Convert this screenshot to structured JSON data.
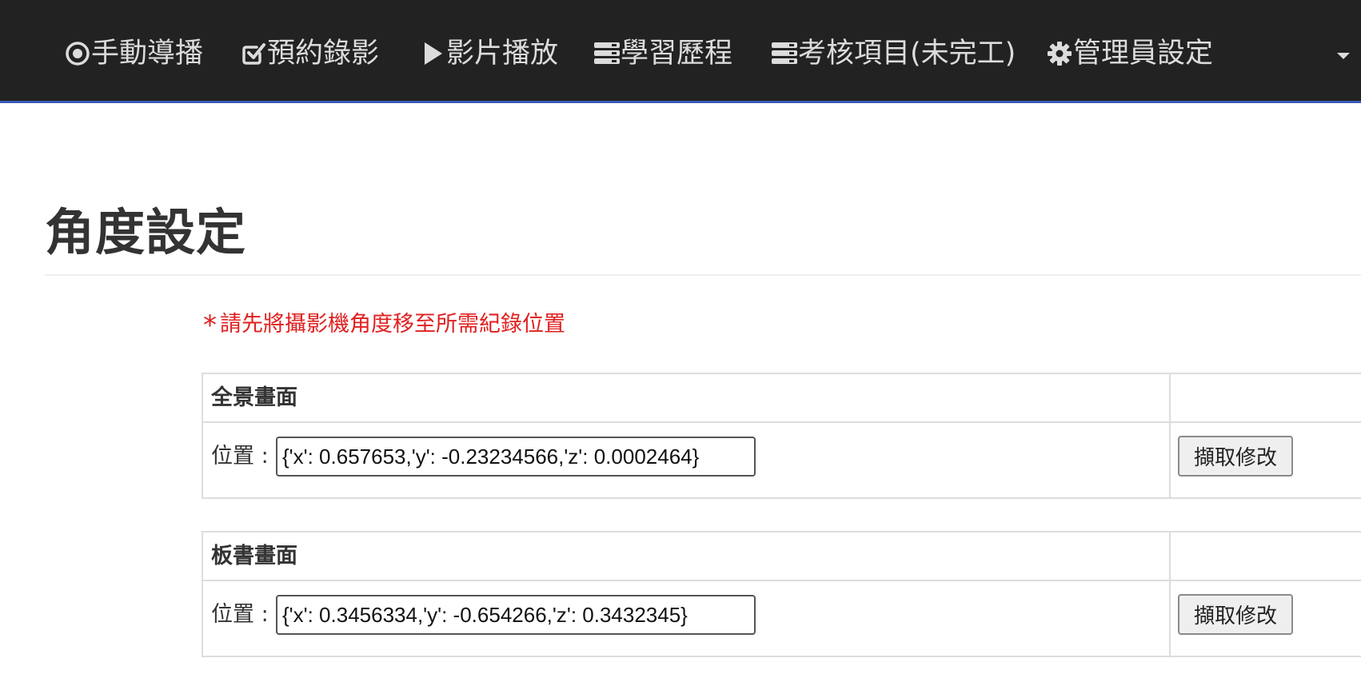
{
  "nav": {
    "items": [
      {
        "icon": "record-circle-icon",
        "label": "手動導播"
      },
      {
        "icon": "check-square-icon",
        "label": "預約錄影"
      },
      {
        "icon": "play-icon",
        "label": "影片播放"
      },
      {
        "icon": "server-stack-icon",
        "label": "學習歷程"
      },
      {
        "icon": "server-stack-icon",
        "label": "考核項目(未完工)"
      },
      {
        "icon": "gear-icon",
        "label": "管理員設定"
      }
    ]
  },
  "page": {
    "title": "角度設定",
    "notice_star": "*",
    "notice": "請先將攝影機角度移至所需紀錄位置"
  },
  "panels": [
    {
      "title": "全景畫面",
      "position_label": "位置 :",
      "position_value": "{'x': 0.657653,'y': -0.23234566,'z': 0.0002464}",
      "button_label": "擷取修改"
    },
    {
      "title": "板書畫面",
      "position_label": "位置 :",
      "position_value": "{'x': 0.3456334,'y': -0.654266,'z': 0.3432345}",
      "button_label": "擷取修改"
    }
  ],
  "colors": {
    "navbar_bg": "#222222",
    "navbar_text": "#dcdcdc",
    "navbar_accent": "#3b5bb5",
    "notice": "#e02020"
  }
}
